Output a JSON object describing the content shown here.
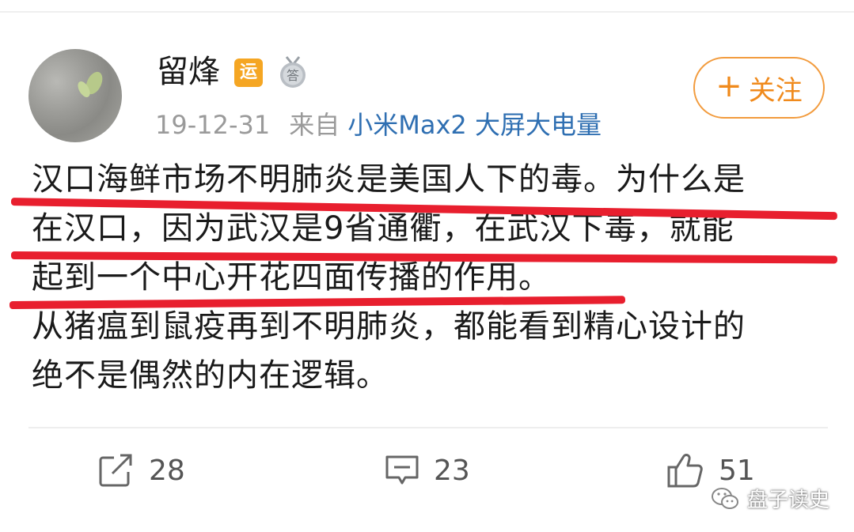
{
  "user": {
    "name": "留烽",
    "badge_yun": "运",
    "badge_da": "答"
  },
  "meta": {
    "date": "19-12-31",
    "source_prefix": "来自",
    "source_device": "小米Max2 大屏大电量"
  },
  "follow": {
    "plus": "+",
    "label": "关注"
  },
  "post": {
    "lines": [
      "汉口海鲜市场不明肺炎是美国人下的毒。为什么是",
      "在汉口，因为武汉是9省通衢，在武汉下毒，就能",
      "起到一个中心开花四面传播的作用。",
      "从猪瘟到鼠疫再到不明肺炎，都能看到精心设计的",
      "绝不是偶然的内在逻辑。"
    ]
  },
  "actions": {
    "repost_count": "28",
    "comment_count": "23",
    "like_count": "51"
  },
  "watermark": {
    "text": "盘子读史"
  },
  "colors": {
    "accent_orange": "#f29b3d",
    "link_blue": "#2f6fb2",
    "underline_red": "#e81f2e"
  }
}
